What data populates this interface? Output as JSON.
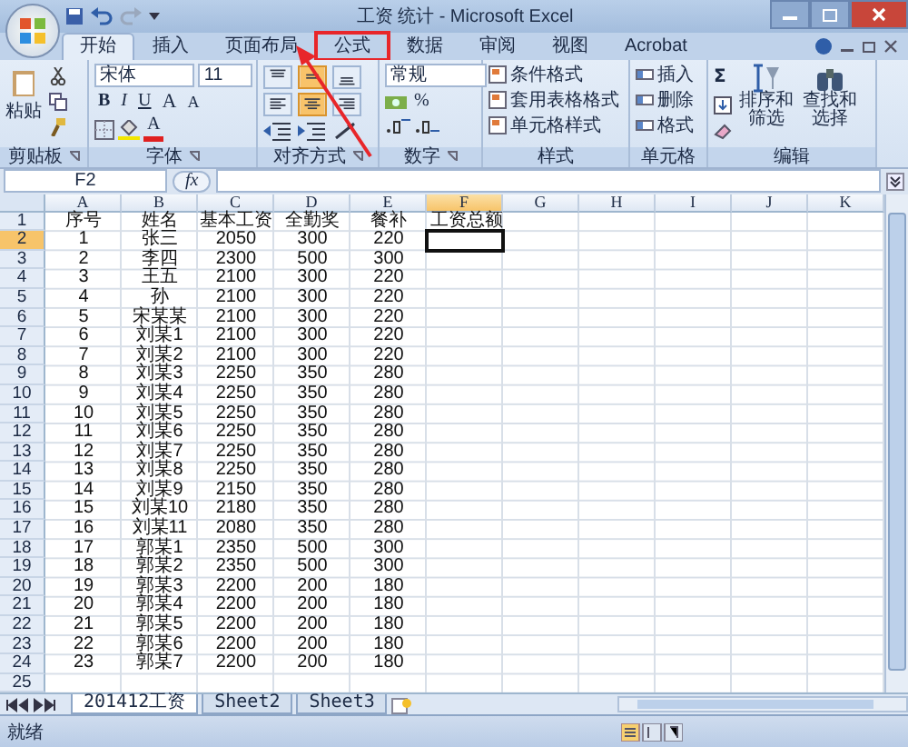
{
  "window": {
    "title": "工资 统计 - Microsoft Excel"
  },
  "tabs": [
    {
      "label": "开始",
      "selected": true,
      "annotated": false
    },
    {
      "label": "插入",
      "selected": false,
      "annotated": false
    },
    {
      "label": "页面布局",
      "selected": false,
      "annotated": false
    },
    {
      "label": "公式",
      "selected": false,
      "annotated": true
    },
    {
      "label": "数据",
      "selected": false,
      "annotated": false
    },
    {
      "label": "审阅",
      "selected": false,
      "annotated": false
    },
    {
      "label": "视图",
      "selected": false,
      "annotated": false
    },
    {
      "label": "Acrobat",
      "selected": false,
      "annotated": false
    }
  ],
  "ribbon": {
    "clipboard": {
      "paste": "粘贴",
      "label": "剪贴板"
    },
    "font": {
      "name": "宋体",
      "size": "11",
      "buttons": [
        {
          "kind": "bold",
          "text": "B"
        },
        {
          "kind": "italic",
          "text": "I"
        },
        {
          "kind": "underline",
          "text": "U"
        },
        {
          "kind": "grow",
          "text": "A"
        },
        {
          "kind": "shrink",
          "text": "A"
        }
      ],
      "color_text": "A",
      "label": "字体"
    },
    "alignment": {
      "buttons": [
        {
          "kind": "top",
          "on": false
        },
        {
          "kind": "middle",
          "on": true
        },
        {
          "kind": "bottom",
          "on": false
        },
        {
          "kind": "left",
          "on": false
        },
        {
          "kind": "center",
          "on": true
        },
        {
          "kind": "right",
          "on": false
        }
      ],
      "label": "对齐方式"
    },
    "number": {
      "format": "常规",
      "percent": "%",
      "label": "数字"
    },
    "styles": {
      "items": [
        "条件格式",
        "套用表格格式",
        "单元格样式"
      ],
      "label": "样式"
    },
    "cells": {
      "items": [
        "插入",
        "删除",
        "格式"
      ],
      "label": "单元格"
    },
    "editing": {
      "sum": "Σ",
      "sort": "排序和筛选",
      "find": "查找和选择",
      "label": "编辑"
    }
  },
  "formula_bar": {
    "name_box": "F2",
    "fx": "fx"
  },
  "sheet": {
    "columns": [
      {
        "label": "A",
        "selected": false
      },
      {
        "label": "B",
        "selected": false
      },
      {
        "label": "C",
        "selected": false
      },
      {
        "label": "D",
        "selected": false
      },
      {
        "label": "E",
        "selected": false
      },
      {
        "label": "F",
        "selected": true
      },
      {
        "label": "G",
        "selected": false
      },
      {
        "label": "H",
        "selected": false
      },
      {
        "label": "I",
        "selected": false
      },
      {
        "label": "J",
        "selected": false
      },
      {
        "label": "K",
        "selected": false
      }
    ],
    "rows": [
      {
        "number": "1",
        "selected": false,
        "cells": [
          "序号",
          "姓名",
          "基本工资",
          "全勤奖",
          "餐补",
          "工资总额"
        ]
      },
      {
        "number": "2",
        "selected": true,
        "cells": [
          "1",
          "张三",
          "2050",
          "300",
          "220"
        ]
      },
      {
        "number": "3",
        "selected": false,
        "cells": [
          "2",
          "李四",
          "2300",
          "500",
          "300"
        ]
      },
      {
        "number": "4",
        "selected": false,
        "cells": [
          "3",
          "王五",
          "2100",
          "300",
          "220"
        ]
      },
      {
        "number": "5",
        "selected": false,
        "cells": [
          "4",
          "孙",
          "2100",
          "300",
          "220"
        ]
      },
      {
        "number": "6",
        "selected": false,
        "cells": [
          "5",
          "宋某某",
          "2100",
          "300",
          "220"
        ]
      },
      {
        "number": "7",
        "selected": false,
        "cells": [
          "6",
          "刘某1",
          "2100",
          "300",
          "220"
        ]
      },
      {
        "number": "8",
        "selected": false,
        "cells": [
          "7",
          "刘某2",
          "2100",
          "300",
          "220"
        ]
      },
      {
        "number": "9",
        "selected": false,
        "cells": [
          "8",
          "刘某3",
          "2250",
          "350",
          "280"
        ]
      },
      {
        "number": "10",
        "selected": false,
        "cells": [
          "9",
          "刘某4",
          "2250",
          "350",
          "280"
        ]
      },
      {
        "number": "11",
        "selected": false,
        "cells": [
          "10",
          "刘某5",
          "2250",
          "350",
          "280"
        ]
      },
      {
        "number": "12",
        "selected": false,
        "cells": [
          "11",
          "刘某6",
          "2250",
          "350",
          "280"
        ]
      },
      {
        "number": "13",
        "selected": false,
        "cells": [
          "12",
          "刘某7",
          "2250",
          "350",
          "280"
        ]
      },
      {
        "number": "14",
        "selected": false,
        "cells": [
          "13",
          "刘某8",
          "2250",
          "350",
          "280"
        ]
      },
      {
        "number": "15",
        "selected": false,
        "cells": [
          "14",
          "刘某9",
          "2150",
          "350",
          "280"
        ]
      },
      {
        "number": "16",
        "selected": false,
        "cells": [
          "15",
          "刘某10",
          "2180",
          "350",
          "280"
        ]
      },
      {
        "number": "17",
        "selected": false,
        "cells": [
          "16",
          "刘某11",
          "2080",
          "350",
          "280"
        ]
      },
      {
        "number": "18",
        "selected": false,
        "cells": [
          "17",
          "郭某1",
          "2350",
          "500",
          "300"
        ]
      },
      {
        "number": "19",
        "selected": false,
        "cells": [
          "18",
          "郭某2",
          "2350",
          "500",
          "300"
        ]
      },
      {
        "number": "20",
        "selected": false,
        "cells": [
          "19",
          "郭某3",
          "2200",
          "200",
          "180"
        ]
      },
      {
        "number": "21",
        "selected": false,
        "cells": [
          "20",
          "郭某4",
          "2200",
          "200",
          "180"
        ]
      },
      {
        "number": "22",
        "selected": false,
        "cells": [
          "21",
          "郭某5",
          "2200",
          "200",
          "180"
        ]
      },
      {
        "number": "23",
        "selected": false,
        "cells": [
          "22",
          "郭某6",
          "2200",
          "200",
          "180"
        ]
      },
      {
        "number": "24",
        "selected": false,
        "cells": [
          "23",
          "郭某7",
          "2200",
          "200",
          "180"
        ]
      },
      {
        "number": "25",
        "selected": false
      }
    ]
  },
  "sheet_tabs": [
    {
      "label": "201412工资",
      "selected": true
    },
    {
      "label": "Sheet2",
      "selected": false
    },
    {
      "label": "Sheet3",
      "selected": false
    }
  ],
  "status_bar": {
    "text": "就绪"
  }
}
